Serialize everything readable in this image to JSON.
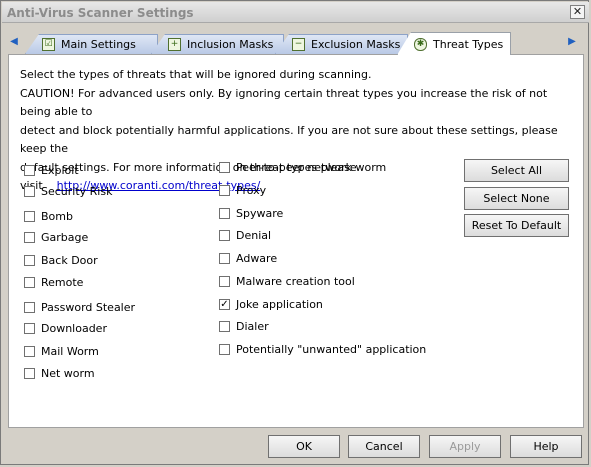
{
  "window": {
    "title": "Anti-Virus Scanner Settings",
    "close_glyph": "✕"
  },
  "tabs": [
    {
      "label": "Main Settings"
    },
    {
      "label": "Inclusion Masks"
    },
    {
      "label": "Exclusion Masks"
    },
    {
      "label": "Threat Types"
    }
  ],
  "description": {
    "line1": "Select the types of threats that will be ignored during scanning.",
    "line2": "CAUTION! For advanced users only. By ignoring certain threat types you increase the risk of not being able to",
    "line3": "detect and block potentially harmful applications. If you are not sure about these settings, please keep the",
    "line4": "default settings. For more information on threat types please visit",
    "link": "http://www.coranti.com/threat-types/"
  },
  "threats_left": [
    {
      "label": "Exploit",
      "checked": false
    },
    {
      "label": "Security Risk",
      "checked": false
    },
    {
      "label": "Bomb",
      "checked": false
    },
    {
      "label": "Garbage",
      "checked": false
    },
    {
      "label": "Back Door",
      "checked": false
    },
    {
      "label": "Remote",
      "checked": false
    },
    {
      "label": "Password Stealer",
      "checked": false
    },
    {
      "label": "Downloader",
      "checked": false
    },
    {
      "label": "Mail Worm",
      "checked": false
    },
    {
      "label": "Net worm",
      "checked": false
    }
  ],
  "threats_right": [
    {
      "label": "Peer-to-peer network worm",
      "checked": false
    },
    {
      "label": "Proxy",
      "checked": false
    },
    {
      "label": "Spyware",
      "checked": false
    },
    {
      "label": "Denial",
      "checked": false
    },
    {
      "label": "Adware",
      "checked": false
    },
    {
      "label": "Malware creation tool",
      "checked": false
    },
    {
      "label": "Joke application",
      "checked": true
    },
    {
      "label": "Dialer",
      "checked": false
    },
    {
      "label": "Potentially \"unwanted\" application",
      "checked": false
    }
  ],
  "side_buttons": {
    "select_all": "Select All",
    "select_none": "Select None",
    "reset_default": "Reset To Default"
  },
  "footer_buttons": {
    "ok": "OK",
    "cancel": "Cancel",
    "apply": "Apply",
    "help": "Help"
  },
  "check_glyph": "✓"
}
